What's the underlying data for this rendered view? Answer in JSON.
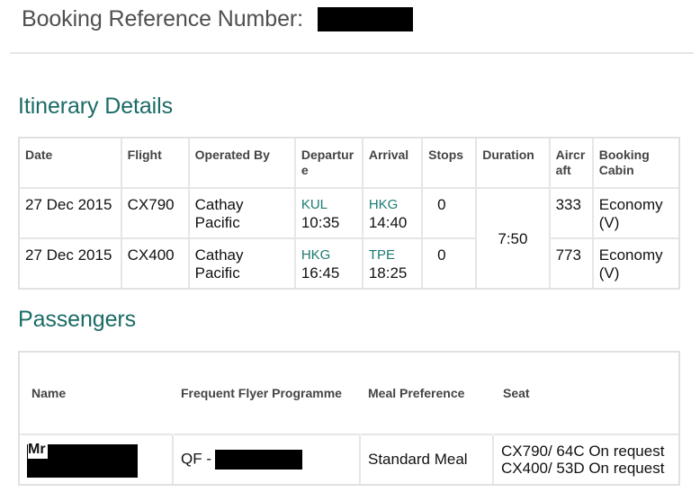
{
  "header": {
    "booking_ref_label": "Booking Reference Number:",
    "booking_ref_value": "[redacted]"
  },
  "itinerary": {
    "title": "Itinerary Details",
    "columns": [
      "Date",
      "Flight",
      "Operated By",
      "Departur e",
      "Arrival",
      "Stops",
      "Duration",
      "Aircr aft",
      "Booking Cabin"
    ],
    "duration_total": "7:50",
    "rows": [
      {
        "date": "27 Dec 2015",
        "flight": "CX790",
        "operated_by": "Cathay Pacific",
        "departure_code": "KUL",
        "departure_time": "10:35",
        "arrival_code": "HKG",
        "arrival_time": "14:40",
        "stops": "0",
        "aircraft": "333",
        "cabin": "Economy (V)"
      },
      {
        "date": "27 Dec 2015",
        "flight": "CX400",
        "operated_by": "Cathay Pacific",
        "departure_code": "HKG",
        "departure_time": "16:45",
        "arrival_code": "TPE",
        "arrival_time": "18:25",
        "stops": "0",
        "aircraft": "773",
        "cabin": "Economy (V)"
      }
    ]
  },
  "passengers": {
    "title": "Passengers",
    "columns": [
      "Name",
      "Frequent Flyer Programme",
      "Meal Preference",
      "Seat"
    ],
    "rows": [
      {
        "title": "Mr",
        "name": "[redacted]",
        "ff_prefix": "QF -",
        "ff_number": "[redacted]",
        "meal": "Standard Meal",
        "seat_1": "CX790/ 64C On request",
        "seat_2": "CX400/ 53D On request"
      }
    ]
  },
  "colors": {
    "accent_teal": "#1b6b66",
    "airport_code": "#1b7a72",
    "border": "#e1e1e1"
  }
}
